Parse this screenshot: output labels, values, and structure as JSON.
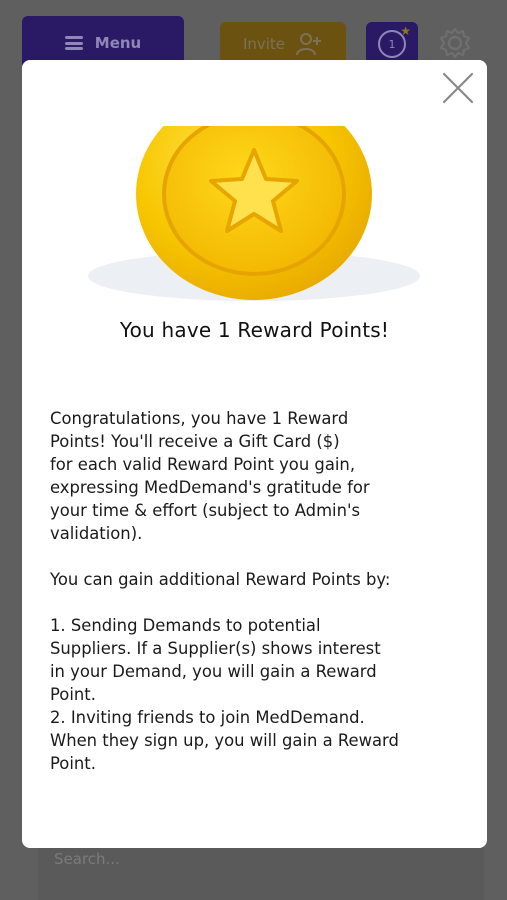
{
  "header": {
    "menu_label": "Menu",
    "invite_label": "Invite",
    "points_count": "1"
  },
  "search": {
    "placeholder": "Search..."
  },
  "modal": {
    "title": "You have 1 Reward Points!",
    "paragraph1_lines": [
      "Congratulations, you have 1 Reward",
      "Points! You'll receive a Gift Card ($)",
      "for each valid Reward Point you gain,",
      "expressing MedDemand's gratitude for",
      "your time & effort (subject to Admin's",
      "validation)."
    ],
    "paragraph2": "You can gain additional Reward Points by:",
    "list_lines": [
      "1. Sending Demands to potential",
      "Suppliers. If a Supplier(s) shows interest",
      "in your Demand, you will gain a Reward",
      "Point.",
      "2. Inviting friends to join MedDemand.",
      "When they sign up, you will gain a Reward",
      "Point."
    ]
  },
  "colors": {
    "menu_bg": "#2a1a66",
    "invite_bg": "#6b5210",
    "overlay": "#5f5f5f",
    "coin_gold": "#f5c400"
  },
  "icons": [
    "hamburger-icon",
    "add-user-icon",
    "reward-points-icon",
    "gear-icon",
    "close-icon",
    "coin-star-icon"
  ]
}
